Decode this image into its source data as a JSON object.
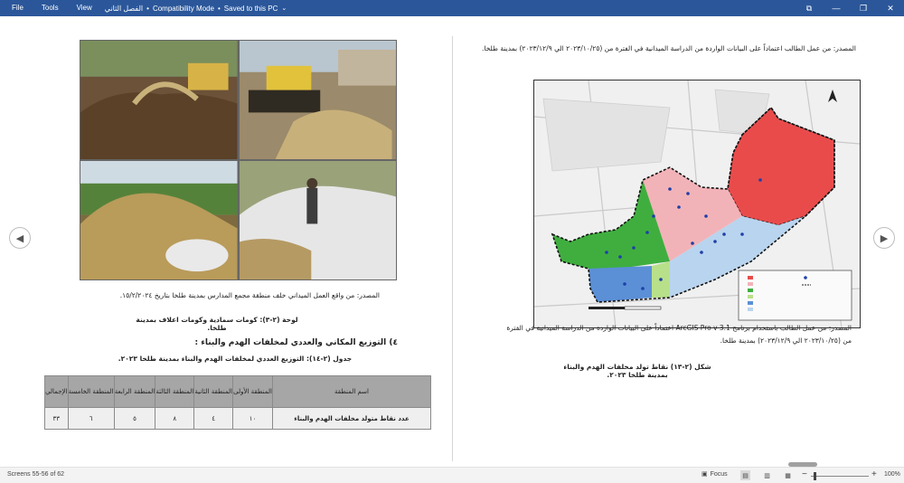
{
  "menu": {
    "file": "File",
    "tools": "Tools",
    "view": "View",
    "doc_name": "الفصل الثاني",
    "mode": "Compatibility Mode",
    "saved": "Saved to this PC"
  },
  "icons": {
    "chevron": "⌄",
    "restore": "⧉",
    "minimize": "—",
    "maximize": "❐",
    "close": "✕",
    "nav_left": "◀",
    "nav_right": "▶",
    "focus": "▣",
    "read_mode": "▤",
    "print_layout": "▥",
    "web_layout": "▦"
  },
  "left_page": {
    "photo_source": "المصدر: من واقع العمل الميداني خلف منطقة مجمع المدارس بمدينة طلخا بتاريخ ١٥/٢/٢٠٢٤.",
    "photo_caption": "لوحة (٢-٣): كومات سمادية وكومات اعلاف بمدينة طلخا.",
    "section_heading": "٤) التوزيع المكاني والعددي لمخلفات الهدم والبناء :",
    "table_title": "جدول (٢-١٤): التوزيع العددي لمخلفات الهدم والبناء بمدينة طلخا ٢٠٢٣.",
    "table": {
      "headers": [
        "اسم المنطقة",
        "المنطقة الأولى",
        "المنطقة الثانية",
        "المنطقة الثالثة",
        "المنطقة الرابعة",
        "المنطقة الخامسة",
        "الإجمالي"
      ],
      "row": [
        "عدد نقاط متولد مخلفات الهدم والبناء",
        "١٠",
        "٤",
        "٨",
        "٥",
        "٦",
        "٣٣"
      ]
    }
  },
  "right_page": {
    "source_top": "المصدر: من عمل الطالب اعتماداً على البيانات الواردة من الدراسة الميدانية في الفترة من (٢٠٢٣/١٠/٢٥ الي ٢٠٢٣/١٢/٩) بمدينة طلخا.",
    "source_bottom": "المصدر: من عمل الطالب باستخدام برنامج ArcGIS Pro v 3.1 اعتماداً على البيانات الواردة من الدراسة الميدانية في الفترة من (٢٠٢٣/١٠/٢٥ الي ٢٠٢٣/١٢/٩) بمدينة طلخا.",
    "figure_caption": "شكل (٢-١٣) نقاط تولد مخلفات الهدم والبناء بمدينة طلخا ٢٠٢٣."
  },
  "status": {
    "screens": "Screens 55-56 of 62",
    "focus": "Focus",
    "zoom_minus": "−",
    "zoom_plus": "+",
    "zoom": "100%"
  },
  "colors": {
    "titlebar": "#2b579a",
    "zone_red": "#e94b4b",
    "zone_pink": "#f2b3b8",
    "zone_green": "#3fae3f",
    "zone_lightgreen": "#b8e08a",
    "zone_blue": "#5b8fd6",
    "zone_lightblue": "#b9d4ee"
  }
}
